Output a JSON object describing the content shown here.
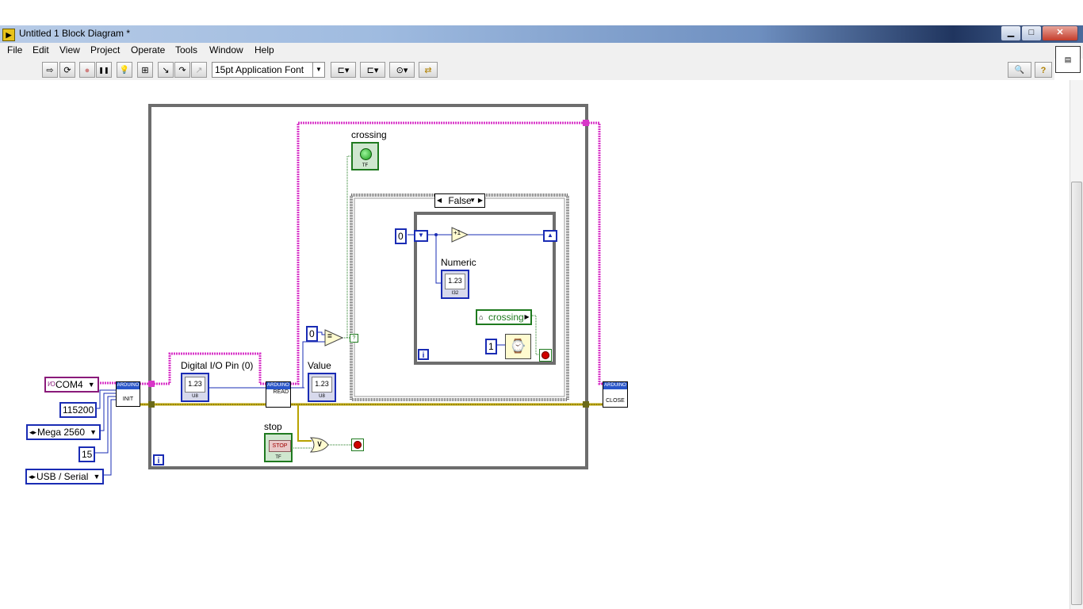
{
  "window": {
    "title": "Untitled 1 Block Diagram *",
    "min": "▁",
    "max": "□",
    "close": "✕"
  },
  "menu": [
    "File",
    "Edit",
    "View",
    "Project",
    "Operate",
    "Tools",
    "Window",
    "Help"
  ],
  "toolbar": {
    "font": "15pt Application Font",
    "run": "⇨",
    "run_cont": "⟳",
    "abort": "●",
    "pause": "❚❚",
    "highlight": "💡",
    "probe": "⊞",
    "step_into": "↘",
    "step_over": "↷",
    "step_out": "↗",
    "align": "⊏▾",
    "distribute": "⊏▾",
    "reorder": "⊙▾",
    "cleanup": "⇄",
    "search": "🔍",
    "help": "?"
  },
  "diagram": {
    "com_port": "COM4",
    "baud": "115200",
    "board": "Mega 2560",
    "bytes": "15",
    "conn": "USB / Serial",
    "digital_pin_label": "Digital I/O Pin (0)",
    "digital_pin_num": "1.23",
    "digital_pin_type": "U8",
    "value_label": "Value",
    "value_num": "1.23",
    "value_type": "U8",
    "zero_const": "0",
    "crossing_label": "crossing",
    "crossing_type": "TF",
    "case_selector": "False",
    "inner_zero": "0",
    "numeric_label": "Numeric",
    "numeric_num": "1.23",
    "numeric_type": "I32",
    "local_var": "crossing",
    "wait_const": "1",
    "stop_label": "stop",
    "stop_text": "STOP",
    "stop_type": "TF",
    "iter": "i",
    "inner_iter": "i",
    "init_txt": "INIT",
    "read_txt": "READ",
    "close_txt": "CLOSE",
    "arduino_txt": "ARDUINO",
    "plus_one": "+1",
    "equal_sym": "=",
    "or_sym": "∨",
    "wait_sym": "⌚",
    "shift_down": "▼",
    "shift_up": "▲",
    "local_arrow": "🏠",
    "visa_glyph": "I⁄O"
  },
  "colors": {
    "loop": "#6d6d6d",
    "visa_wire": "#d836c8",
    "error_wire": "#b8a200",
    "numeric": "#1a2cb4",
    "bool": "#1f7a1f"
  }
}
